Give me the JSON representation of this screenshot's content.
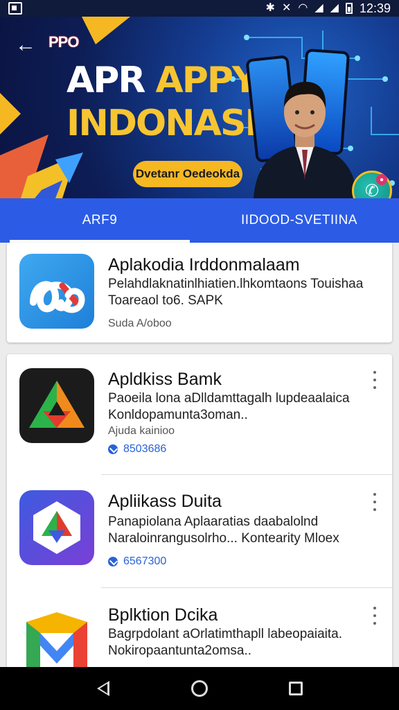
{
  "status_bar": {
    "time": "12:39",
    "icons": [
      "bluetooth-icon",
      "mute-icon",
      "wifi-icon",
      "signal-icon",
      "battery-icon"
    ]
  },
  "banner": {
    "brand": "PPO",
    "title_line1_a": "APR",
    "title_line1_b": "APPY",
    "title_line2": "INDONASIA",
    "cta_label": "Dvetanr Oedeokda",
    "colors": {
      "bg": "#0d1d55",
      "accent": "#f7c531",
      "brand": "#e32b3a"
    }
  },
  "tabs": [
    {
      "label": "ARF9",
      "active": true
    },
    {
      "label": "IIDOOD-SVETIINA",
      "active": false
    }
  ],
  "apps": [
    {
      "title": "Aplakodia Irddonmalaam",
      "desc_line1": "Pelahdlaknatinlhiatien.lhkomtaons Touishaa",
      "desc_line2": "Toareaol to6. SAPK",
      "meta": "Suda A/oboo",
      "count": "",
      "icon": "ao-logo-icon"
    },
    {
      "title": "Apldkiss Bamk",
      "desc_line1": "Paoeila lona aDlldamttagalh lupdeaalaica",
      "desc_line2": "Konldopamunta3oman..",
      "meta": "Ajuda kainioo",
      "count": "8503686",
      "icon": "triangle-logo-icon"
    },
    {
      "title": "Apliikass Duita",
      "desc_line1": "Panapiolana Aplaaratias daabalolnd",
      "desc_line2": "Naraloinrangusolrho...  Kontearity Mloex",
      "meta": "",
      "count": "6567300",
      "icon": "hexagon-logo-icon"
    },
    {
      "title": "Bplktion Dcika",
      "desc_line1": "Bagrpdolant aOrlatimthapll labeopaiaita.",
      "desc_line2": "Nokiropaantunta2omsa..",
      "meta": "",
      "count": "",
      "icon": "m-logo-icon"
    }
  ]
}
